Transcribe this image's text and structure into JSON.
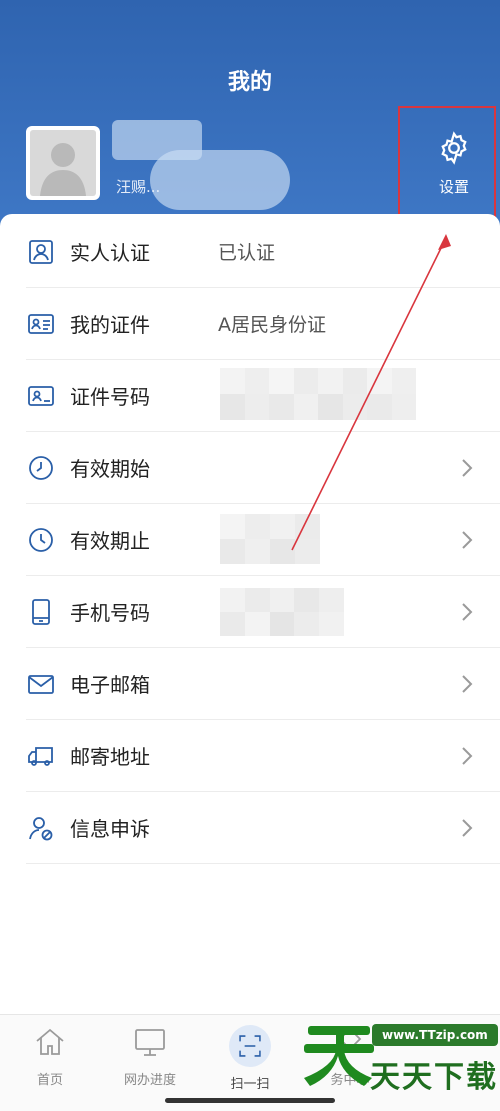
{
  "header": {
    "title": "我的",
    "user_name_partial": "汪赐..."
  },
  "settings": {
    "label": "设置",
    "icon": "gear-icon"
  },
  "menu": [
    {
      "label": "实人认证",
      "value": "已认证",
      "icon": "id-portrait-icon",
      "chevron": false
    },
    {
      "label": "我的证件",
      "value": "A居民身份证",
      "icon": "id-card-icon",
      "chevron": false
    },
    {
      "label": "证件号码",
      "value": "",
      "icon": "id-number-icon",
      "chevron": false
    },
    {
      "label": "有效期始",
      "value": "",
      "icon": "clock-start-icon",
      "chevron": true
    },
    {
      "label": "有效期止",
      "value": "",
      "icon": "clock-end-icon",
      "chevron": true
    },
    {
      "label": "手机号码",
      "value": "",
      "icon": "phone-icon",
      "chevron": true
    },
    {
      "label": "电子邮箱",
      "value": "",
      "icon": "mail-icon",
      "chevron": true
    },
    {
      "label": "邮寄地址",
      "value": "",
      "icon": "truck-icon",
      "chevron": true
    },
    {
      "label": "信息申诉",
      "value": "",
      "icon": "user-appeal-icon",
      "chevron": true
    }
  ],
  "tabbar": {
    "items": [
      {
        "label": "首页",
        "icon": "home-icon"
      },
      {
        "label": "网办进度",
        "icon": "monitor-icon"
      },
      {
        "label": "扫一扫",
        "icon": "scan-icon"
      },
      {
        "label": "务中心",
        "icon": "service-icon"
      }
    ]
  },
  "watermark": {
    "url": "www.TTzip.com",
    "text": "天天下载"
  },
  "colors": {
    "header_blue": "#2f64b0",
    "icon_blue": "#2a5fa8",
    "annotation_red": "#d9363e",
    "watermark_green": "#1f6e1f"
  }
}
